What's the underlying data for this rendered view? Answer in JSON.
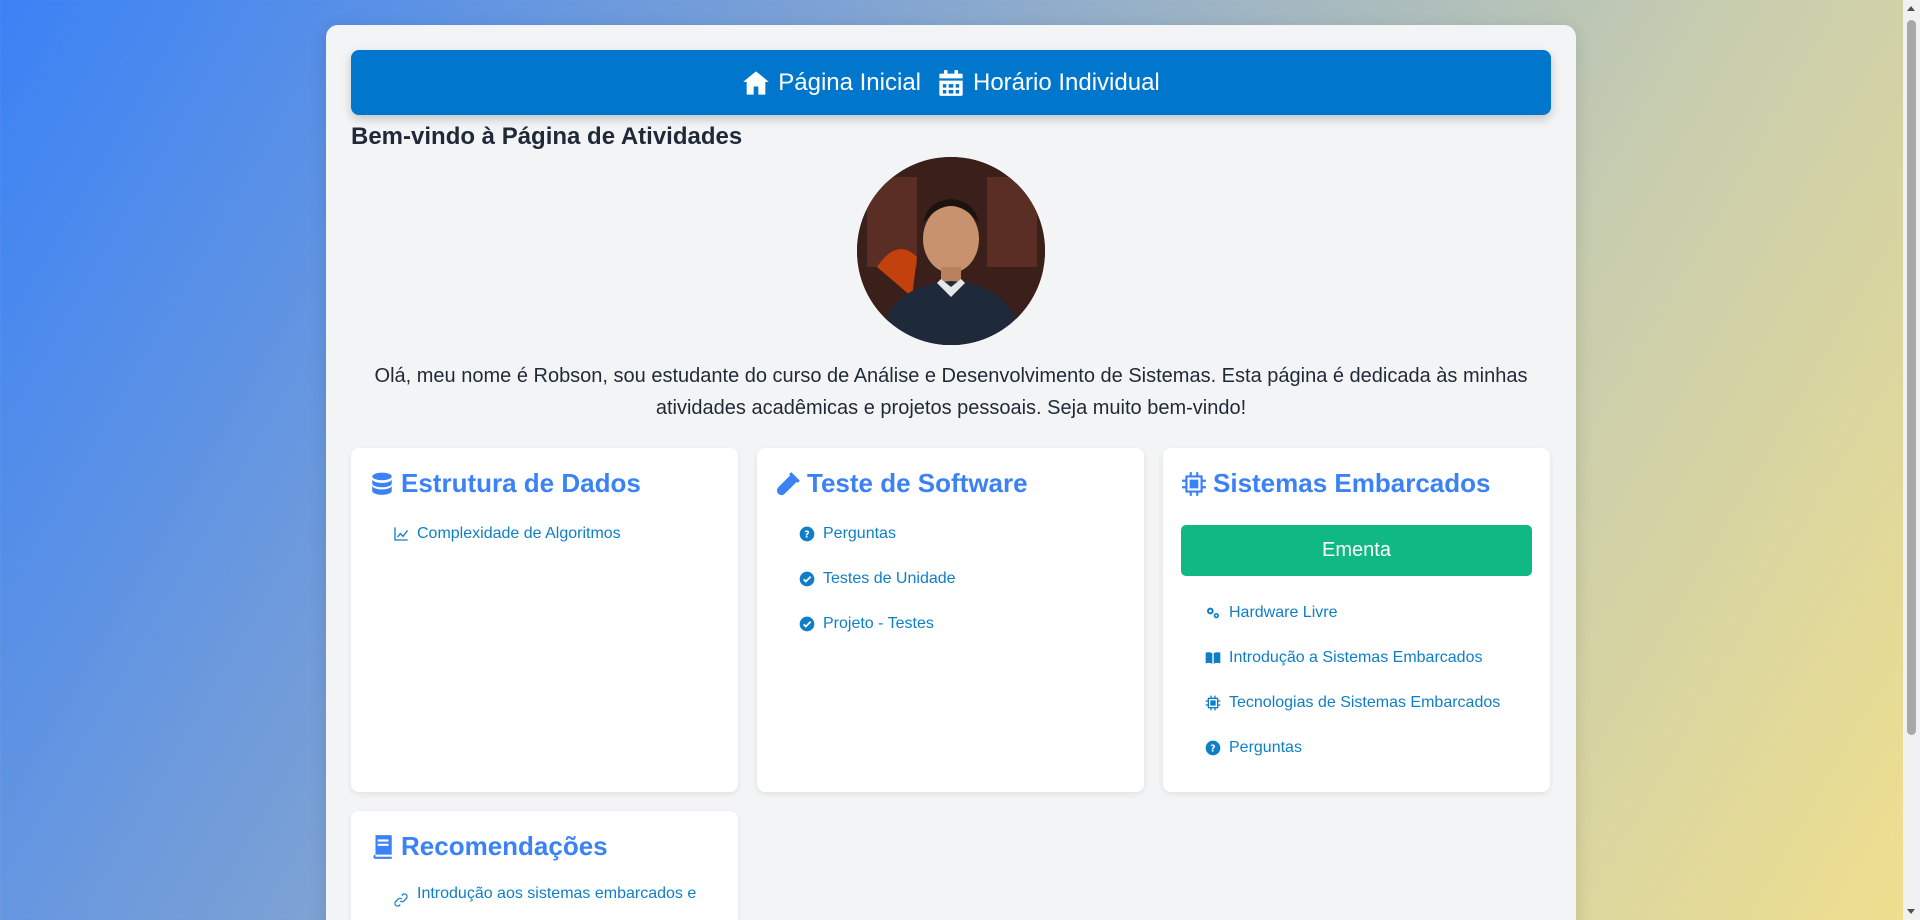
{
  "navbar": {
    "home_label": "Página Inicial",
    "schedule_label": "Horário Individual"
  },
  "page_title": "Bem-vindo à Página de Atividades",
  "intro_text": "Olá, meu nome é Robson, sou estudante do curso de Análise e Desenvolvimento de Sistemas. Esta página é dedicada às minhas atividades acadêmicas e projetos pessoais. Seja muito bem-vindo!",
  "cards": {
    "data_structures": {
      "title": "Estrutura de Dados",
      "links": [
        "Complexidade de Algoritmos"
      ]
    },
    "software_testing": {
      "title": "Teste de Software",
      "links": [
        "Perguntas",
        "Testes de Unidade",
        "Projeto - Testes"
      ]
    },
    "embedded": {
      "title": "Sistemas Embarcados",
      "button_label": "Ementa",
      "links": [
        "Hardware Livre",
        "Introdução a Sistemas Embarcados",
        "Tecnologias de Sistemas Embarcados",
        "Perguntas"
      ]
    },
    "recommendations": {
      "title": "Recomendações",
      "links": [
        "Introdução aos sistemas embarcados e"
      ]
    }
  },
  "colors": {
    "navbar": "#0077cc",
    "card_title": "#3b82f6",
    "link": "#0e7fc6",
    "ementa_button": "#10b981"
  }
}
